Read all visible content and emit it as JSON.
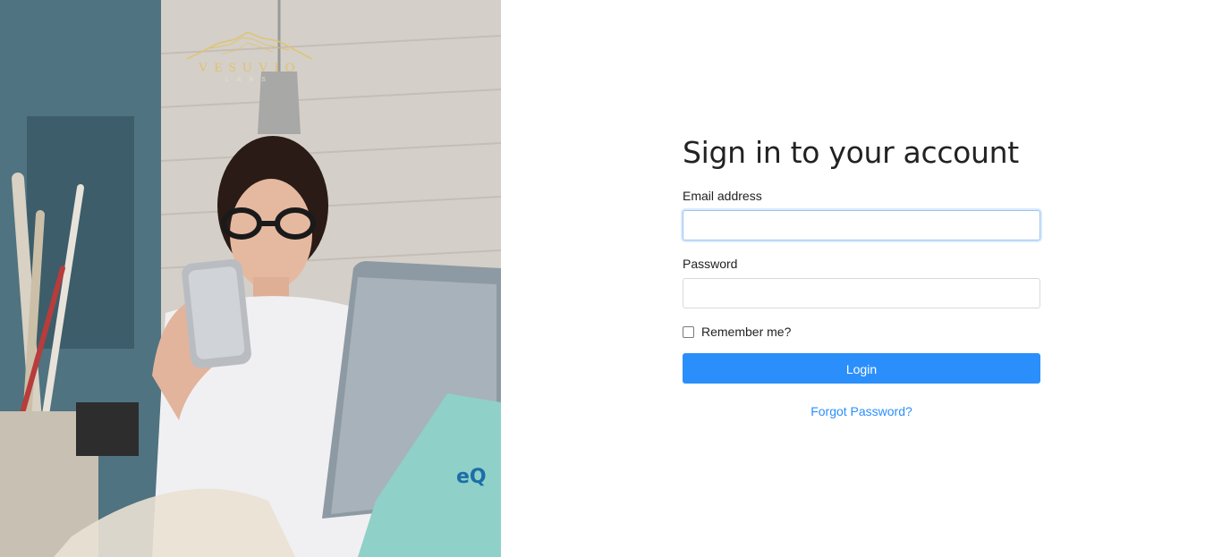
{
  "brand": {
    "logo_word": "VESUVIO",
    "logo_sub": "LABS",
    "logo_color": "#e0c36a"
  },
  "form": {
    "title": "Sign in to your account",
    "email_label": "Email address",
    "email_value": "",
    "password_label": "Password",
    "password_value": "",
    "remember_label": "Remember me?",
    "remember_checked": false,
    "login_label": "Login",
    "forgot_label": "Forgot Password?"
  },
  "colors": {
    "accent": "#2b8ffb",
    "focus_border": "#9ec5ee",
    "input_border": "#d6d9dc"
  },
  "icons": {
    "logo_mark": "mountain-icon"
  }
}
